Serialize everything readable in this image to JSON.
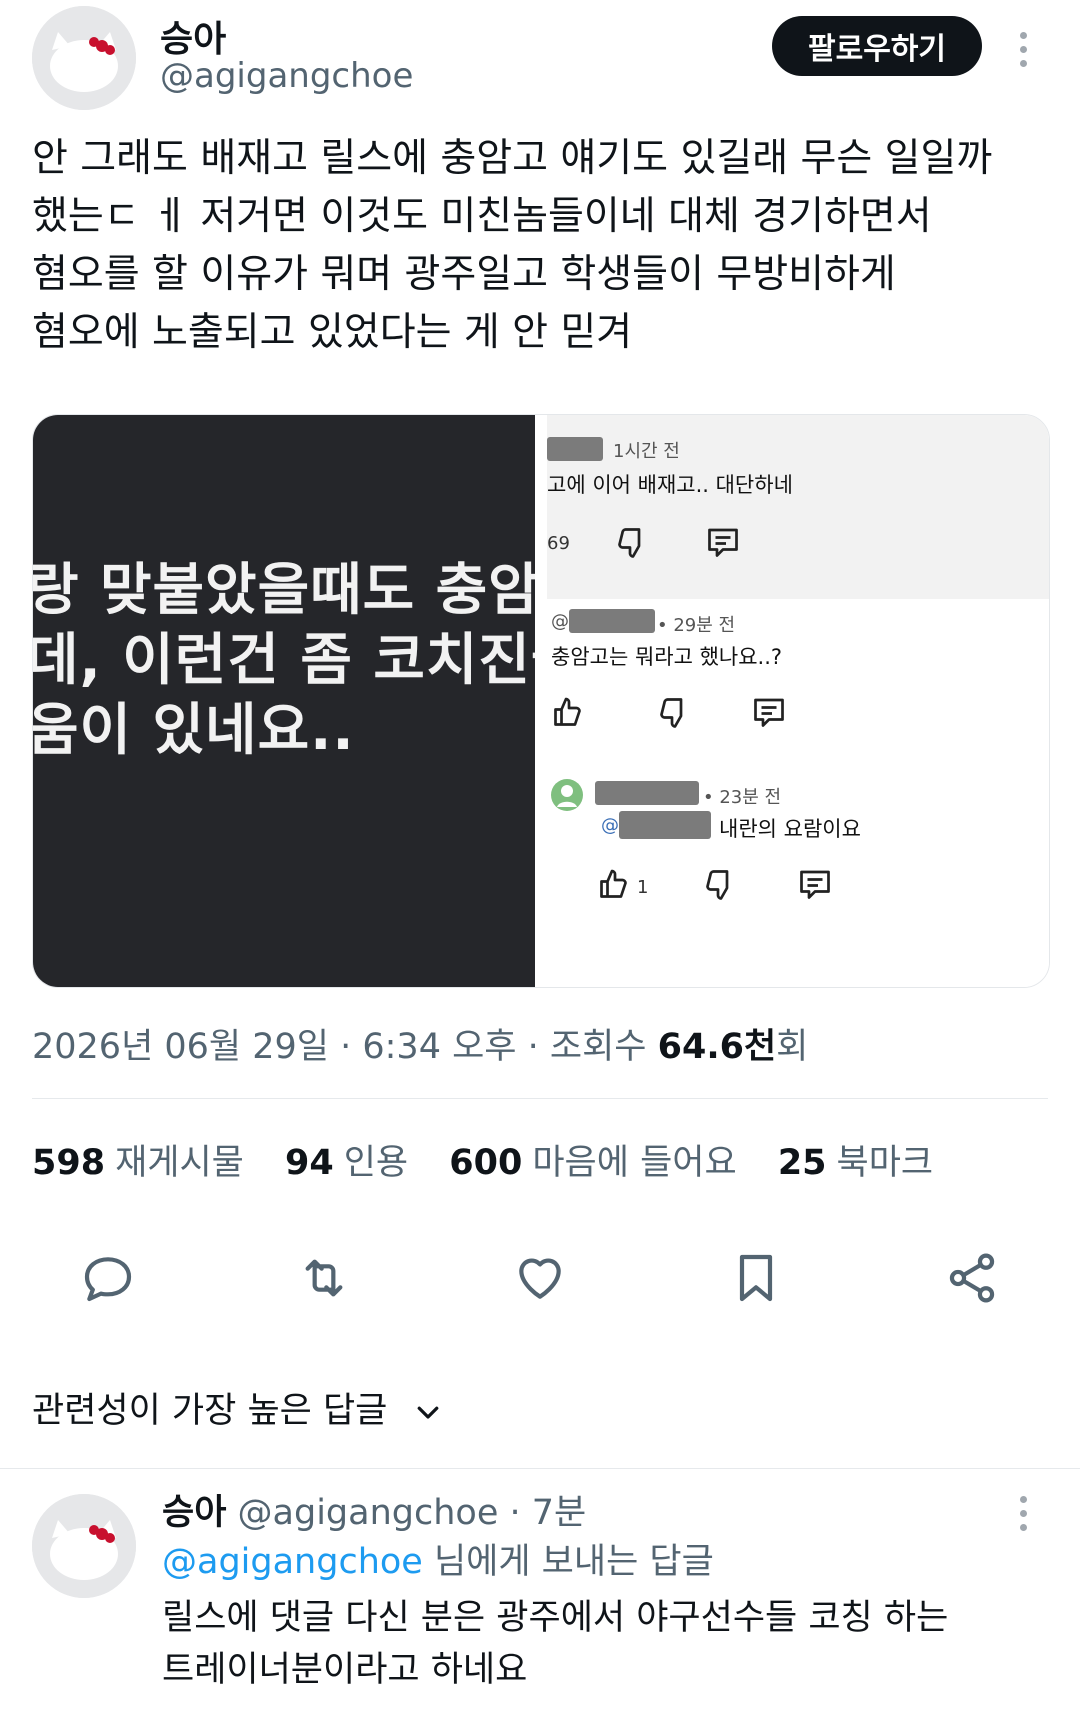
{
  "tweet": {
    "author_name": "승아",
    "author_handle": "@agigangchoe",
    "follow_label": "팔로우하기",
    "text_lines": [
      "안 그래도 배재고 릴스에 충암고 얘기도 있길래 무슨 일일까",
      "했는ㄷ ㅔ 저거면 이것도 미친놈들이네 대체 경기하면서",
      "혐오를 할 이유가 뭐며 광주일고 학생들이 무방비하게",
      "혐오에 노출되고 있었다는 게 안 믿겨"
    ],
    "media_left_lines": [
      "랑 맞붙았을때도 충암",
      "데, 이런건 좀 코치진들",
      "움이 있네요.."
    ],
    "media_right": {
      "c1_time": "1시간 전",
      "c1_text": "고에 이어 배재고.. 대단하네",
      "c1_likes": "69",
      "c2_time": "• 29분 전",
      "c2_text": "충암고는 뭐라고 했나요..?",
      "c3_time": "• 23분 전",
      "c3_mention": "@",
      "c3_text": "내란의 요람이요",
      "c3_likes": "1"
    },
    "meta_date": "2026년 06월 29일 · 6:34 오후 · 조회수 ",
    "meta_views": "64.6천",
    "meta_views_suffix": "회",
    "stats": {
      "retweets_count": "598",
      "retweets_label": "재게시물",
      "quotes_count": "94",
      "quotes_label": "인용",
      "likes_count": "600",
      "likes_label": "마음에 들어요",
      "bookmarks_count": "25",
      "bookmarks_label": "북마크"
    }
  },
  "sort_label": "관련성이 가장 높은 답글",
  "reply": {
    "author_name": "승아",
    "author_handle": "@agigangchoe",
    "time": "· 7분",
    "to_handle": "@agigangchoe",
    "to_suffix": " 님에게 보내는 답글",
    "text_lines": [
      "릴스에 댓글 다신 분은 광주에서 야구선수들 코칭 하는",
      "트레이너분이라고 하네요"
    ]
  },
  "colors": {
    "accent": "#1d9bf0",
    "text": "#0f1419",
    "muted": "#536471"
  },
  "icons": [
    "reply-icon",
    "retweet-icon",
    "like-icon",
    "bookmark-icon",
    "share-icon",
    "chevron-down-icon",
    "more-icon",
    "thumb-up-icon",
    "thumb-down-icon",
    "comment-icon"
  ]
}
